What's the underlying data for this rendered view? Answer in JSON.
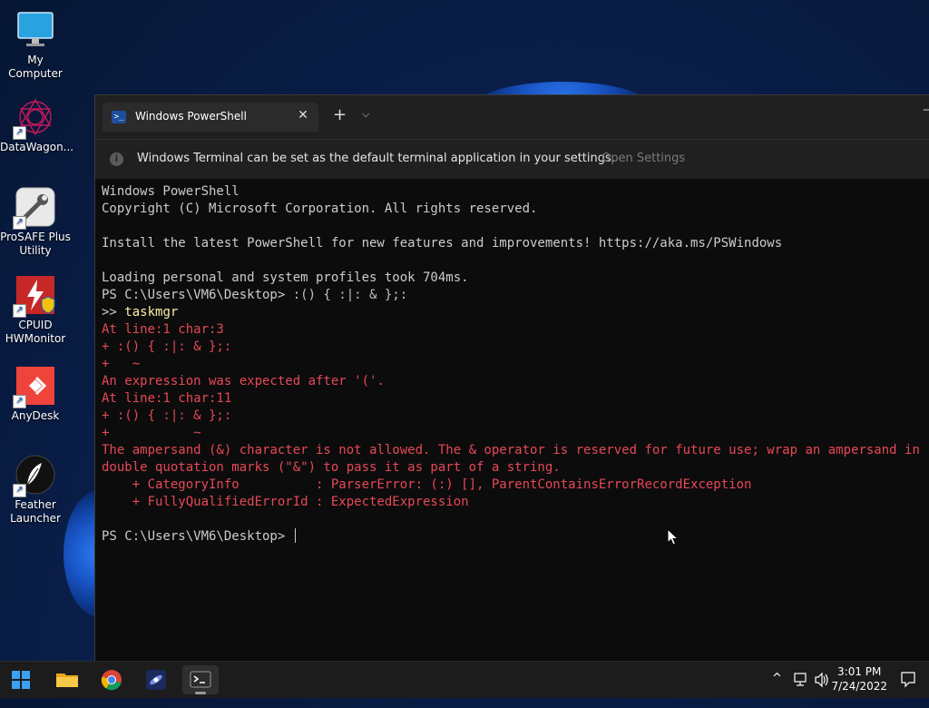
{
  "desktop": {
    "icons": [
      {
        "label": "My Computer",
        "icon": "monitor-icon"
      },
      {
        "label": "DataWagon...",
        "icon": "datawagon-icon"
      },
      {
        "label": "ProSAFE Plus Utility",
        "icon": "wrench-icon"
      },
      {
        "label": "CPUID HWMonitor",
        "icon": "hwmonitor-icon"
      },
      {
        "label": "AnyDesk",
        "icon": "anydesk-icon"
      },
      {
        "label": "Feather Launcher",
        "icon": "feather-icon"
      }
    ]
  },
  "terminal": {
    "tab_title": "Windows PowerShell",
    "tab_close": "✕",
    "new_tab": "+",
    "dropdown": "⌵",
    "minimize": "—",
    "infobar": {
      "message": "Windows Terminal can be set as the default terminal application in your settings.",
      "link": "Open Settings"
    },
    "lines": [
      {
        "text": "Windows PowerShell",
        "style": "normal"
      },
      {
        "text": "Copyright (C) Microsoft Corporation. All rights reserved.",
        "style": "normal"
      },
      {
        "text": "",
        "style": "normal"
      },
      {
        "text": "Install the latest PowerShell for new features and improvements! https://aka.ms/PSWindows",
        "style": "normal"
      },
      {
        "text": "",
        "style": "normal"
      },
      {
        "text": "Loading personal and system profiles took 704ms.",
        "style": "normal"
      },
      {
        "text": "PS C:\\Users\\VM6\\Desktop> :() { :|: & };:",
        "style": "prompt"
      },
      {
        "text": ">> taskmgr",
        "style": "continuation"
      },
      {
        "text": "At line:1 char:3",
        "style": "error"
      },
      {
        "text": "+ :() { :|: & };:",
        "style": "error"
      },
      {
        "text": "+   ~",
        "style": "error"
      },
      {
        "text": "An expression was expected after '('.",
        "style": "error"
      },
      {
        "text": "At line:1 char:11",
        "style": "error"
      },
      {
        "text": "+ :() { :|: & };:",
        "style": "error"
      },
      {
        "text": "+           ~",
        "style": "error"
      },
      {
        "text": "The ampersand (&) character is not allowed. The & operator is reserved for future use; wrap an ampersand in",
        "style": "error"
      },
      {
        "text": "double quotation marks (\"&\") to pass it as part of a string.",
        "style": "error"
      },
      {
        "text": "    + CategoryInfo          : ParserError: (:) [], ParentContainsErrorRecordException",
        "style": "error"
      },
      {
        "text": "    + FullyQualifiedErrorId : ExpectedExpression",
        "style": "error"
      },
      {
        "text": "",
        "style": "normal"
      },
      {
        "text": "PS C:\\Users\\VM6\\Desktop> ",
        "style": "cursor-prompt"
      }
    ]
  },
  "taskbar": {
    "apps": [
      {
        "name": "start",
        "icon": "windows-logo-icon"
      },
      {
        "name": "file-explorer",
        "icon": "folder-icon"
      },
      {
        "name": "chrome",
        "icon": "chrome-icon"
      },
      {
        "name": "app",
        "icon": "galaxy-icon"
      },
      {
        "name": "terminal",
        "icon": "terminal-icon",
        "active": true
      }
    ],
    "tray": {
      "chevron": "^",
      "time": "3:01 PM",
      "date": "7/24/2022"
    }
  }
}
